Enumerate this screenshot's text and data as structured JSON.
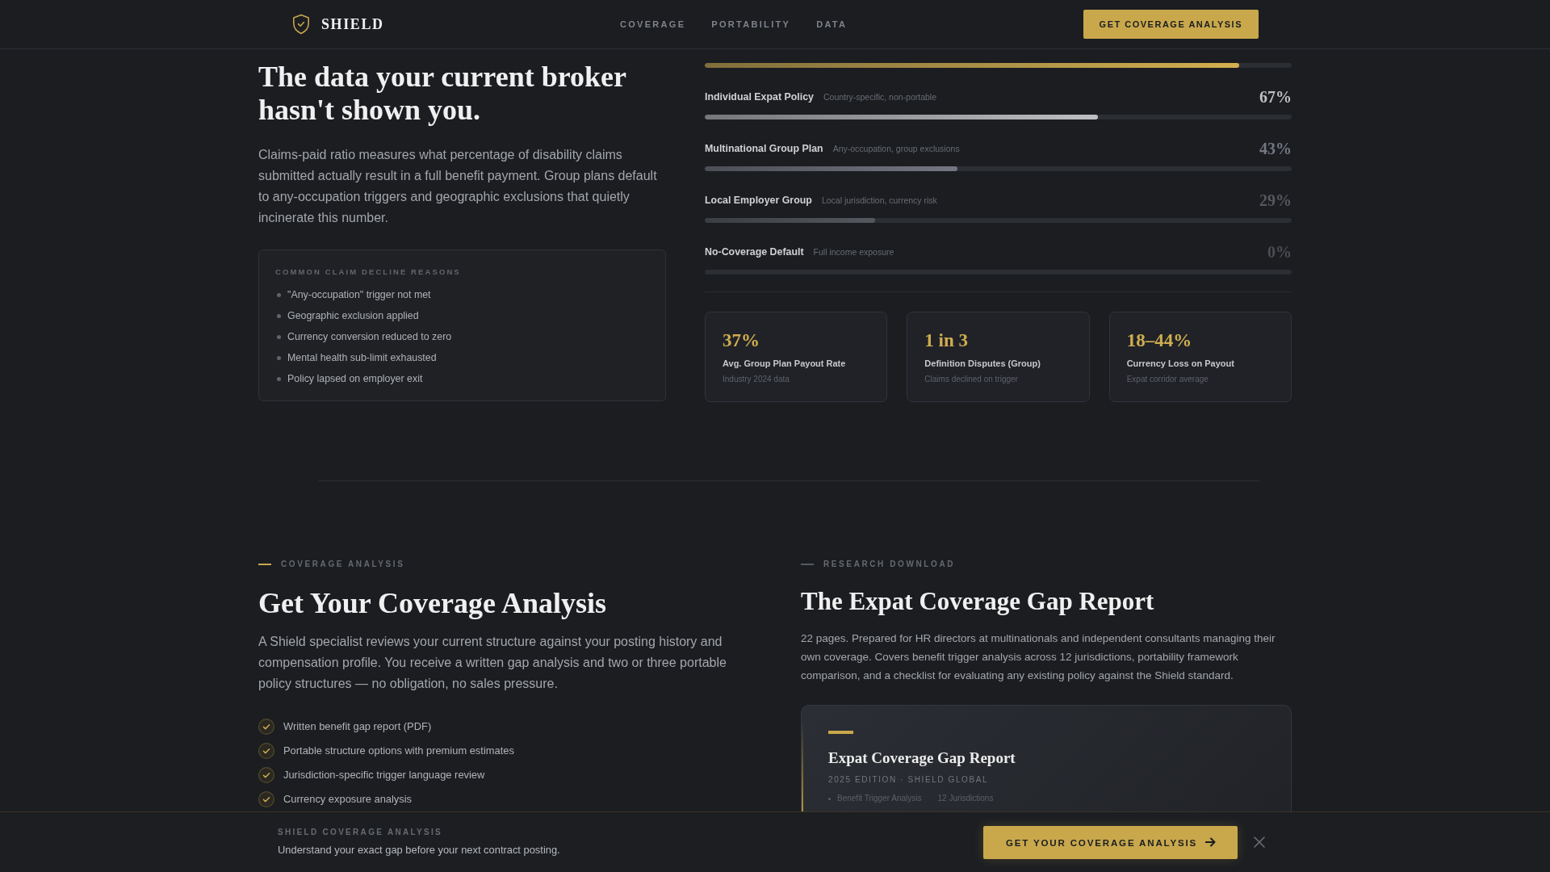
{
  "nav": {
    "brand": "SHIELD",
    "links": [
      "COVERAGE",
      "PORTABILITY",
      "DATA"
    ],
    "cta": "GET COVERAGE ANALYSIS"
  },
  "intro": {
    "title": "The data your current broker hasn't shown you.",
    "body": "Claims-paid ratio measures what percentage of disability claims submitted actually result in a full benefit payment. Group plans default to any-occupation triggers and geographic exclusions that quietly incinerate this number.",
    "reasons": {
      "title": "COMMON CLAIM DECLINE REASONS",
      "items": [
        "\"Any-occupation\" trigger not met",
        "Geographic exclusion applied",
        "Currency conversion reduced to zero",
        "Mental health sub-limit exhausted",
        "Policy lapsed on employer exit"
      ]
    }
  },
  "comparison": {
    "rows": [
      {
        "level": 0.91,
        "color": "#d3b04f"
      },
      {
        "label": "Individual Expat Policy",
        "note": "Country-specific, non-portable",
        "value": "67%",
        "level": 0.67,
        "color": "#bdbfc2"
      },
      {
        "label": "Multinational Group Plan",
        "note": "Any-occupation, group exclusions",
        "value": "43%",
        "level": 0.43,
        "color": "#747782"
      },
      {
        "label": "Local Employer Group",
        "note": "Local jurisdiction, currency risk",
        "value": "29%",
        "level": 0.29,
        "color": "#55585e"
      },
      {
        "label": "No-Coverage Default",
        "note": "Full income exposure",
        "value": "0%",
        "level": 0,
        "color": "#4a4d53"
      }
    ],
    "stats": [
      {
        "value": "37%",
        "label": "Avg. Group Plan Payout Rate",
        "note": "Industry 2024 data"
      },
      {
        "value": "1 in 3",
        "label": "Definition Disputes (Group)",
        "note": "Claims declined on trigger"
      },
      {
        "value": "18–44%",
        "label": "Currency Loss on Payout",
        "note": "Expat corridor average"
      }
    ]
  },
  "analysis": {
    "eyebrow": {
      "text": "COVERAGE ANALYSIS",
      "color": "#c9a84c"
    },
    "title": "Get Your Coverage Analysis",
    "body": "A Shield specialist reviews your current structure against your posting history and compensation profile. You receive a written gap analysis and two or three portable policy structures — no obligation, no sales pressure.",
    "checklist": [
      "Written benefit gap report (PDF)",
      "Portable structure options with premium estimates",
      "Jurisdiction-specific trigger language review",
      "Currency exposure analysis"
    ]
  },
  "report": {
    "eyebrow": {
      "text": "RESEARCH DOWNLOAD",
      "color": "#565a61"
    },
    "title": "The Expat Coverage Gap Report",
    "body": "22 pages. Prepared for HR directors at multinationals and independent consultants managing their own coverage. Covers benefit trigger analysis across 12 jurisdictions, portability framework comparison, and a checklist for evaluating any existing policy against the Shield standard.",
    "card": {
      "title": "Expat Coverage Gap Report",
      "meta": "2025 EDITION · SHIELD GLOBAL",
      "contents": [
        {
          "item": "Benefit Trigger Analysis",
          "detail": "12 Jurisdictions"
        }
      ]
    }
  },
  "sticky_bar": {
    "eyebrow": "SHIELD COVERAGE ANALYSIS",
    "text": "Understand your exact gap before your next contract posting.",
    "button": "GET YOUR COVERAGE ANALYSIS"
  }
}
